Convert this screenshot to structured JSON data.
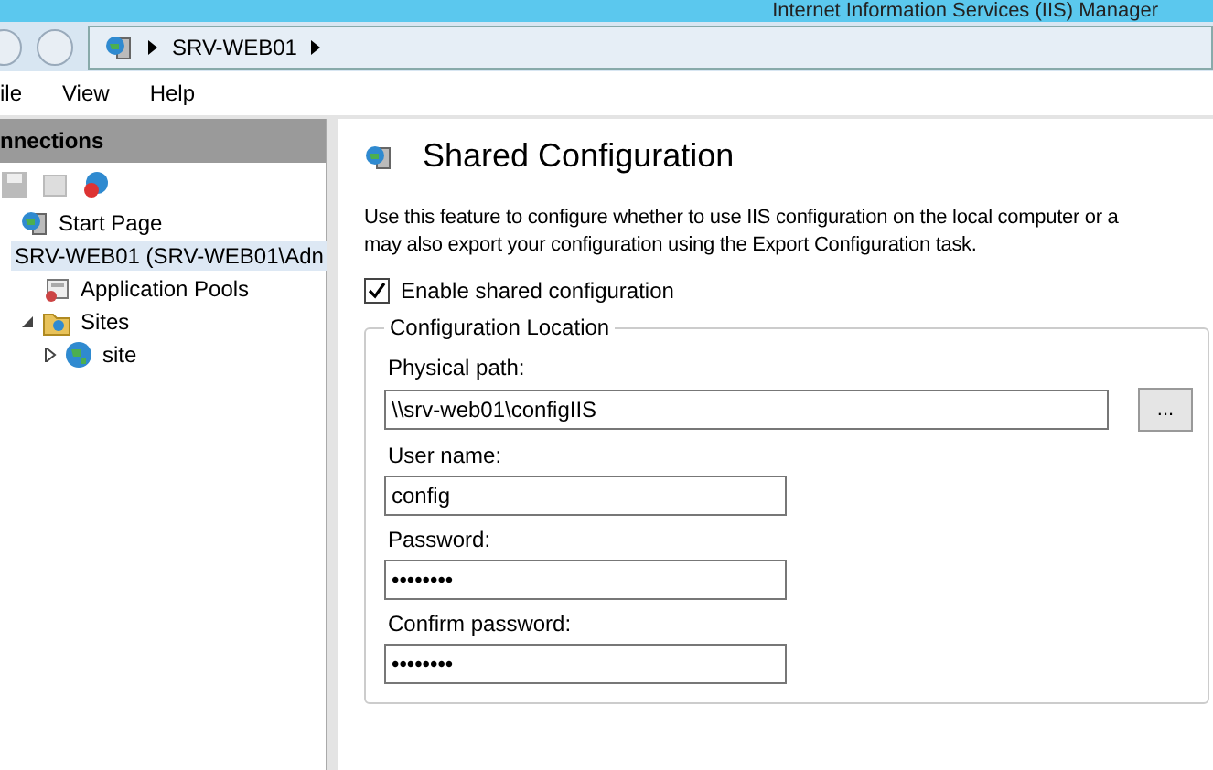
{
  "window": {
    "title": "Internet Information Services (IIS) Manager"
  },
  "address_bar": {
    "crumbs": [
      "SRV-WEB01"
    ]
  },
  "menu": [
    "ile",
    "View",
    "Help"
  ],
  "connections": {
    "title": "nnections",
    "tree": [
      {
        "label": "Start Page"
      },
      {
        "label": "SRV-WEB01 (SRV-WEB01\\Adn",
        "selected": true,
        "children": [
          {
            "label": "Application Pools"
          },
          {
            "label": "Sites",
            "expanded": true,
            "children": [
              {
                "label": "site",
                "expanded": false
              }
            ]
          }
        ]
      }
    ]
  },
  "feature": {
    "title": "Shared Configuration",
    "description": "Use this feature to configure whether to use IIS configuration on the local computer or a\nmay also export your configuration using the Export Configuration task.",
    "enable": {
      "label": "Enable shared configuration",
      "checked": true
    },
    "group": {
      "title": "Configuration Location",
      "fields": [
        {
          "label": "Physical path:",
          "value": "\\\\srv-web01\\configIIS",
          "kind": "path",
          "browse": "..."
        },
        {
          "label": "User name:",
          "value": "config",
          "kind": "text"
        },
        {
          "label": "Password:",
          "value": "••••••••",
          "kind": "text"
        },
        {
          "label": "Confirm password:",
          "value": "••••••••",
          "kind": "text"
        }
      ]
    }
  }
}
